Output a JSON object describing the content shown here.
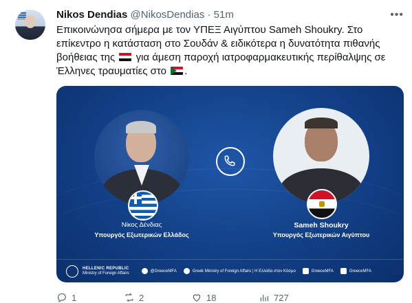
{
  "author": {
    "name": "Nikos Dendias",
    "handle": "@NikosDendias",
    "separator": "·",
    "time": "51m"
  },
  "tweet": {
    "line1": "Επικοινώνησα σήμερα με τον ΥΠΕΞ Αιγύπτου ",
    "mention": "Sameh Shoukry",
    "line1_end": ". Στο",
    "line2": "επίκεντρο η κατάσταση στο Σουδάν & ειδικότερα η δυνατότητα πιθανής",
    "line3_start": "βοήθειας της ",
    "line3_end": " για άμεση παροχή ιατροφαρμακευτικής περίθαλψης σε",
    "line4_start": "Έλληνες τραυματίες στο ",
    "line4_end": "."
  },
  "card": {
    "left_name": "Νίκος Δένδιας",
    "left_role": "Υπουργός Εξωτερικών Ελλάδος",
    "right_name": "Sameh Shoukry",
    "right_role": "Υπουργός Εξωτερικών Αιγύπτου",
    "footer": {
      "ministry_line1": "HELLENIC REPUBLIC",
      "ministry_line2": "Ministry of Foreign Affairs",
      "twitter": "@GreeceMFA",
      "facebook": "Greek Ministry of Foreign Affairs | Η Ελλάδα στον Κόσμο",
      "instagram": "GreeceMFA",
      "youtube": "GreeceMFA"
    }
  },
  "actions": {
    "replies": "1",
    "retweets": "2",
    "likes": "18",
    "views": "727"
  },
  "icons": [
    "more-icon",
    "reply-icon",
    "retweet-icon",
    "like-icon",
    "views-icon",
    "phone-icon"
  ],
  "colors": {
    "card_bg": "#123f86",
    "text": "#0f1419",
    "muted": "#536471"
  }
}
